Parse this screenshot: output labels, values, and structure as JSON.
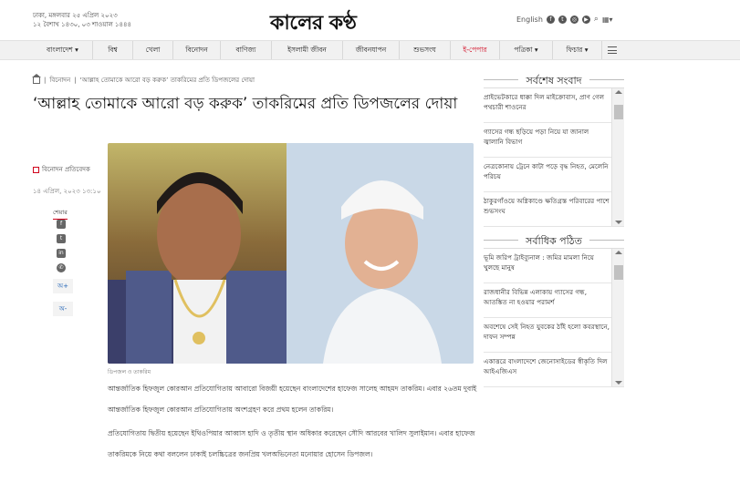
{
  "header": {
    "date_line1": "ঢাকা, মঙ্গলবার ২৫ এপ্রিল ২০২৩",
    "date_line2": "১২ বৈশাখ ১৪৩০, ০৩ শাওয়াল ১৪৪৪",
    "logo": "কালের কণ্ঠ",
    "lang": "English"
  },
  "nav": [
    {
      "label": "বাংলাদেশ ▾"
    },
    {
      "label": "বিশ্ব"
    },
    {
      "label": "খেলা"
    },
    {
      "label": "বিনোদন"
    },
    {
      "label": "বাণিজ্য"
    },
    {
      "label": "ইসলামী জীবন"
    },
    {
      "label": "জীবনযাপন"
    },
    {
      "label": "শুভসংঘ"
    },
    {
      "label": "ই-পেপার"
    },
    {
      "label": "পত্রিকা ▾"
    },
    {
      "label": "ফিচার ▾"
    }
  ],
  "breadcrumb": {
    "section": "বিনোদন",
    "current": "‘আল্লাহ তোমাকে আরো বড় করুক’ তাকরিমের প্রতি ডিপজলের দোয়া"
  },
  "article": {
    "headline": "‘আল্লাহ তোমাকে আরো বড় করুক’ তাকরিমের প্রতি ডিপজলের দোয়া",
    "author": "বিনোদন প্রতিবেদক",
    "date": "১৪ এপ্রিল, ২০২৩ ১৩:১০",
    "share_label": "শেয়ার",
    "font_up": "অ+",
    "font_down": "অ-",
    "caption": "ডিপজল ও তাকরিম",
    "para1": "আন্তর্জাতিক হিফজুল কোরআন প্রতিযোগিতায় আবারো বিজয়ী হয়েছেন বাংলাদেশের হাফেজ সালেহ আহমদ তাকরিম। এবার ২৬তম দুবাই আন্তর্জাতিক হিফজুল কোরআন প্রতিযোগিতায় অংশগ্রহণ করে প্রথম হলেন তাকরিম।",
    "para2": "প্রতিযোগিতায় দ্বিতীয় হয়েছেন ইথিওপিয়ার আব্বাস হাদি ও তৃতীয় স্থান অধিকার করেছেন সৌদি আরবের খালিদ সুলাইমান। এবার হাফেজ তাকরিমকে নিয়ে কথা বললেন ঢাকাই চলচ্চিত্রের জনপ্রিয় খলঅভিনেতা মনোয়ার হোসেন ডিপজল।"
  },
  "sidebar": {
    "latest_title": "সর্বশেষ সংবাদ",
    "latest": [
      {
        "text": "প্রাইভেটকারে ধাক্কা দিল মাইক্রোবাস, প্রাণ গেল পথচারী শাওনের"
      },
      {
        "text": "গ্যাসের গন্ধ ছড়িয়ে পড়া নিয়ে যা জানাল জ্বালানি বিভাগ"
      },
      {
        "text": "নেত্রকোনায় ট্রেনে কাটা পড়ে বৃদ্ধ নিহত, মেলেনি পরিচয়"
      },
      {
        "text": "ঠাকুরগাঁওয়ে অগ্নিকাণ্ডে ক্ষতিগ্রস্ত পরিবারের পাশে শুভসংঘ"
      }
    ],
    "popular_title": "সর্বাধিক পঠিত",
    "popular": [
      {
        "text": "ভূমি জরিপ ট্রাইব্যুনাল : জমির মামলা নিয়ে খুলছে মানুষ"
      },
      {
        "text": "রাজধানীর বিভিন্ন এলাকায় গ্যাসের গন্ধ, আতঙ্কিত না হওয়ার পরামর্শ"
      },
      {
        "text": "অবশেষে সেই নিহত যুবকের ঠাঁই হলো কবরস্থানে, দাফন সম্পন্ন"
      },
      {
        "text": "একাত্তরে বাংলাদেশে জেনোসাইডের স্বীকৃতি দিল আইএজিএস"
      }
    ]
  }
}
